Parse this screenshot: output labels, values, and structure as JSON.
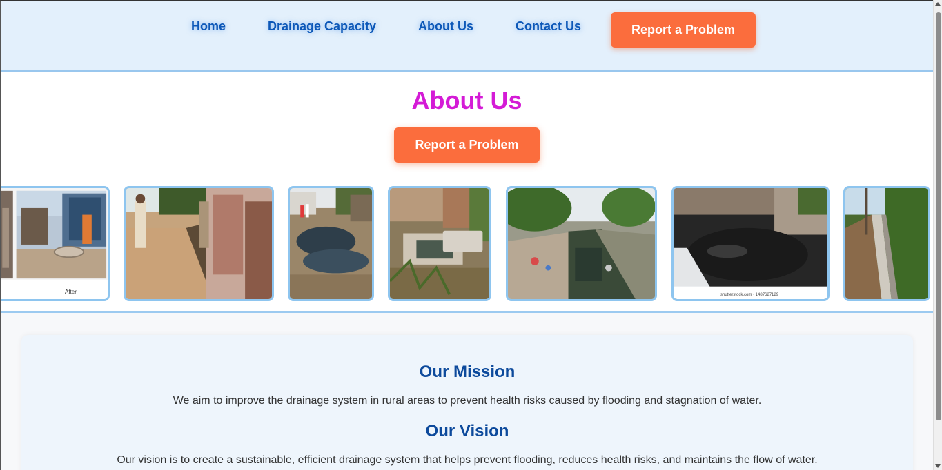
{
  "nav": {
    "items": [
      {
        "label": "Home"
      },
      {
        "label": "Drainage Capacity"
      },
      {
        "label": "About Us"
      },
      {
        "label": "Contact Us"
      }
    ],
    "cta_label": "Report a Problem"
  },
  "hero": {
    "title": "About Us",
    "cta_label": "Report a Problem",
    "gallery": [
      {
        "caption": "After"
      },
      {
        "caption": ""
      },
      {
        "caption": ""
      },
      {
        "caption": ""
      },
      {
        "caption": ""
      },
      {
        "caption": "shutterstock.com · 1487627129"
      },
      {
        "caption": ""
      }
    ]
  },
  "mission": {
    "heading": "Our Mission",
    "text": "We aim to improve the drainage system in rural areas to prevent health risks caused by flooding and stagnation of water."
  },
  "vision": {
    "heading": "Our Vision",
    "text": "Our vision is to create a sustainable, efficient drainage system that helps prevent flooding, reduces health risks, and maintains the flow of water."
  },
  "colors": {
    "accent": "#fb6d3d",
    "title": "#d41bd6",
    "nav_text": "#0d58b8",
    "heading": "#0d4a9c"
  }
}
